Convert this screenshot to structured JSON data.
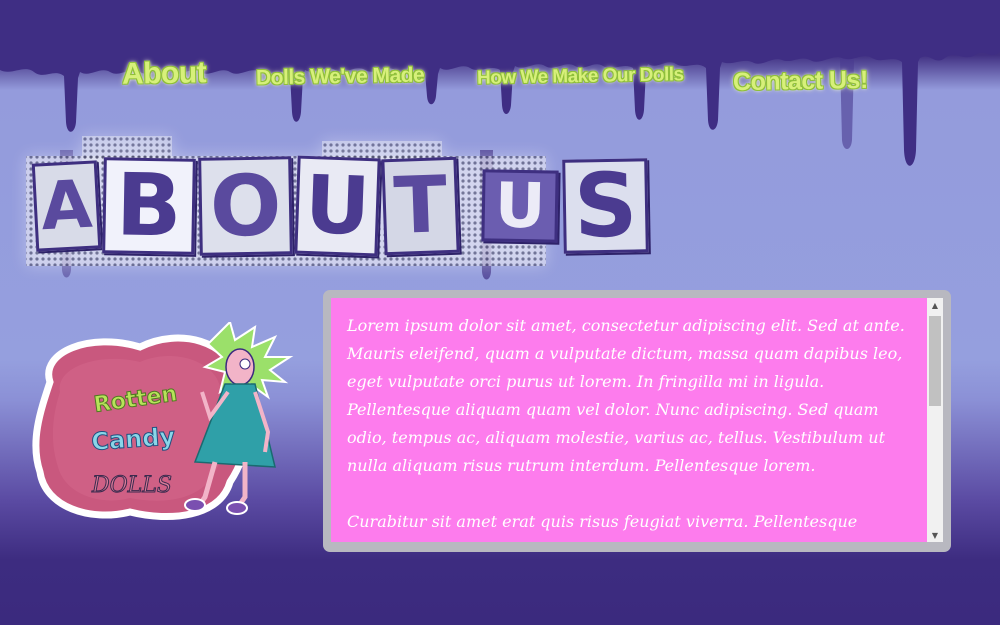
{
  "nav": {
    "items": [
      {
        "label": "About"
      },
      {
        "label": "Dolls We've Made"
      },
      {
        "label": "How We Make Our Dolls"
      },
      {
        "label": "Contact Us!"
      }
    ]
  },
  "heading": {
    "letters": [
      "A",
      "B",
      "O",
      "U",
      "T",
      "U",
      "S"
    ]
  },
  "logo": {
    "line1": "Rotten",
    "line2": "Candy",
    "line3": "DOLLS"
  },
  "content": {
    "paragraphs": [
      "Lorem ipsum dolor sit amet, consectetur adipiscing elit. Sed at ante. Mauris eleifend, quam a vulputate dictum, massa quam dapibus leo, eget vulputate orci purus ut lorem. In fringilla mi in ligula. Pellentesque aliquam quam vel dolor. Nunc adipiscing. Sed quam odio, tempus ac, aliquam molestie, varius ac, tellus. Vestibulum ut nulla aliquam risus rutrum interdum. Pellentesque lorem.",
      "Curabitur sit amet erat quis risus feugiat viverra. Pellentesque augue justo, sagittis et, lacinia at, venenatis non, arcu. Nunc nec libero. In cursus dictum risus."
    ]
  },
  "colors": {
    "nav_text": "#d7f07a",
    "panel_bg": "#fd7ced",
    "drip": "#3f2e84",
    "sky": "#959fde"
  },
  "icons": {
    "scroll_up": "▲",
    "scroll_down": "▼"
  }
}
